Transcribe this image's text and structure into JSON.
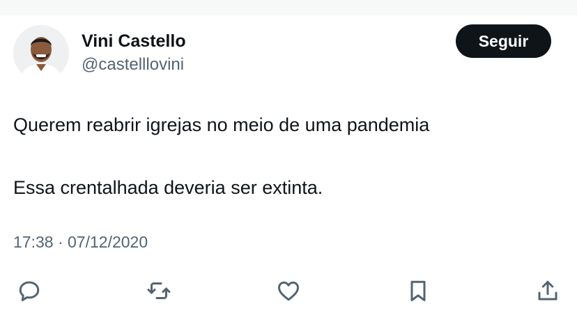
{
  "tweet": {
    "author": {
      "name": "Vini Castello",
      "handle": "@castelllovini"
    },
    "follow_label": "Seguir",
    "text_lines": [
      "Querem reabrir igrejas no meio de uma pandemia",
      "Essa crentalhada deveria ser extinta."
    ],
    "time": "17:38",
    "separator": "·",
    "date": "07/12/2020",
    "actions": [
      {
        "icon": "reply-icon"
      },
      {
        "icon": "retweet-icon"
      },
      {
        "icon": "like-icon"
      },
      {
        "icon": "bookmark-icon"
      },
      {
        "icon": "share-icon"
      }
    ]
  },
  "colors": {
    "text": "#0f1419",
    "secondary": "#536471",
    "button_bg": "#0f1419",
    "button_text": "#ffffff"
  }
}
